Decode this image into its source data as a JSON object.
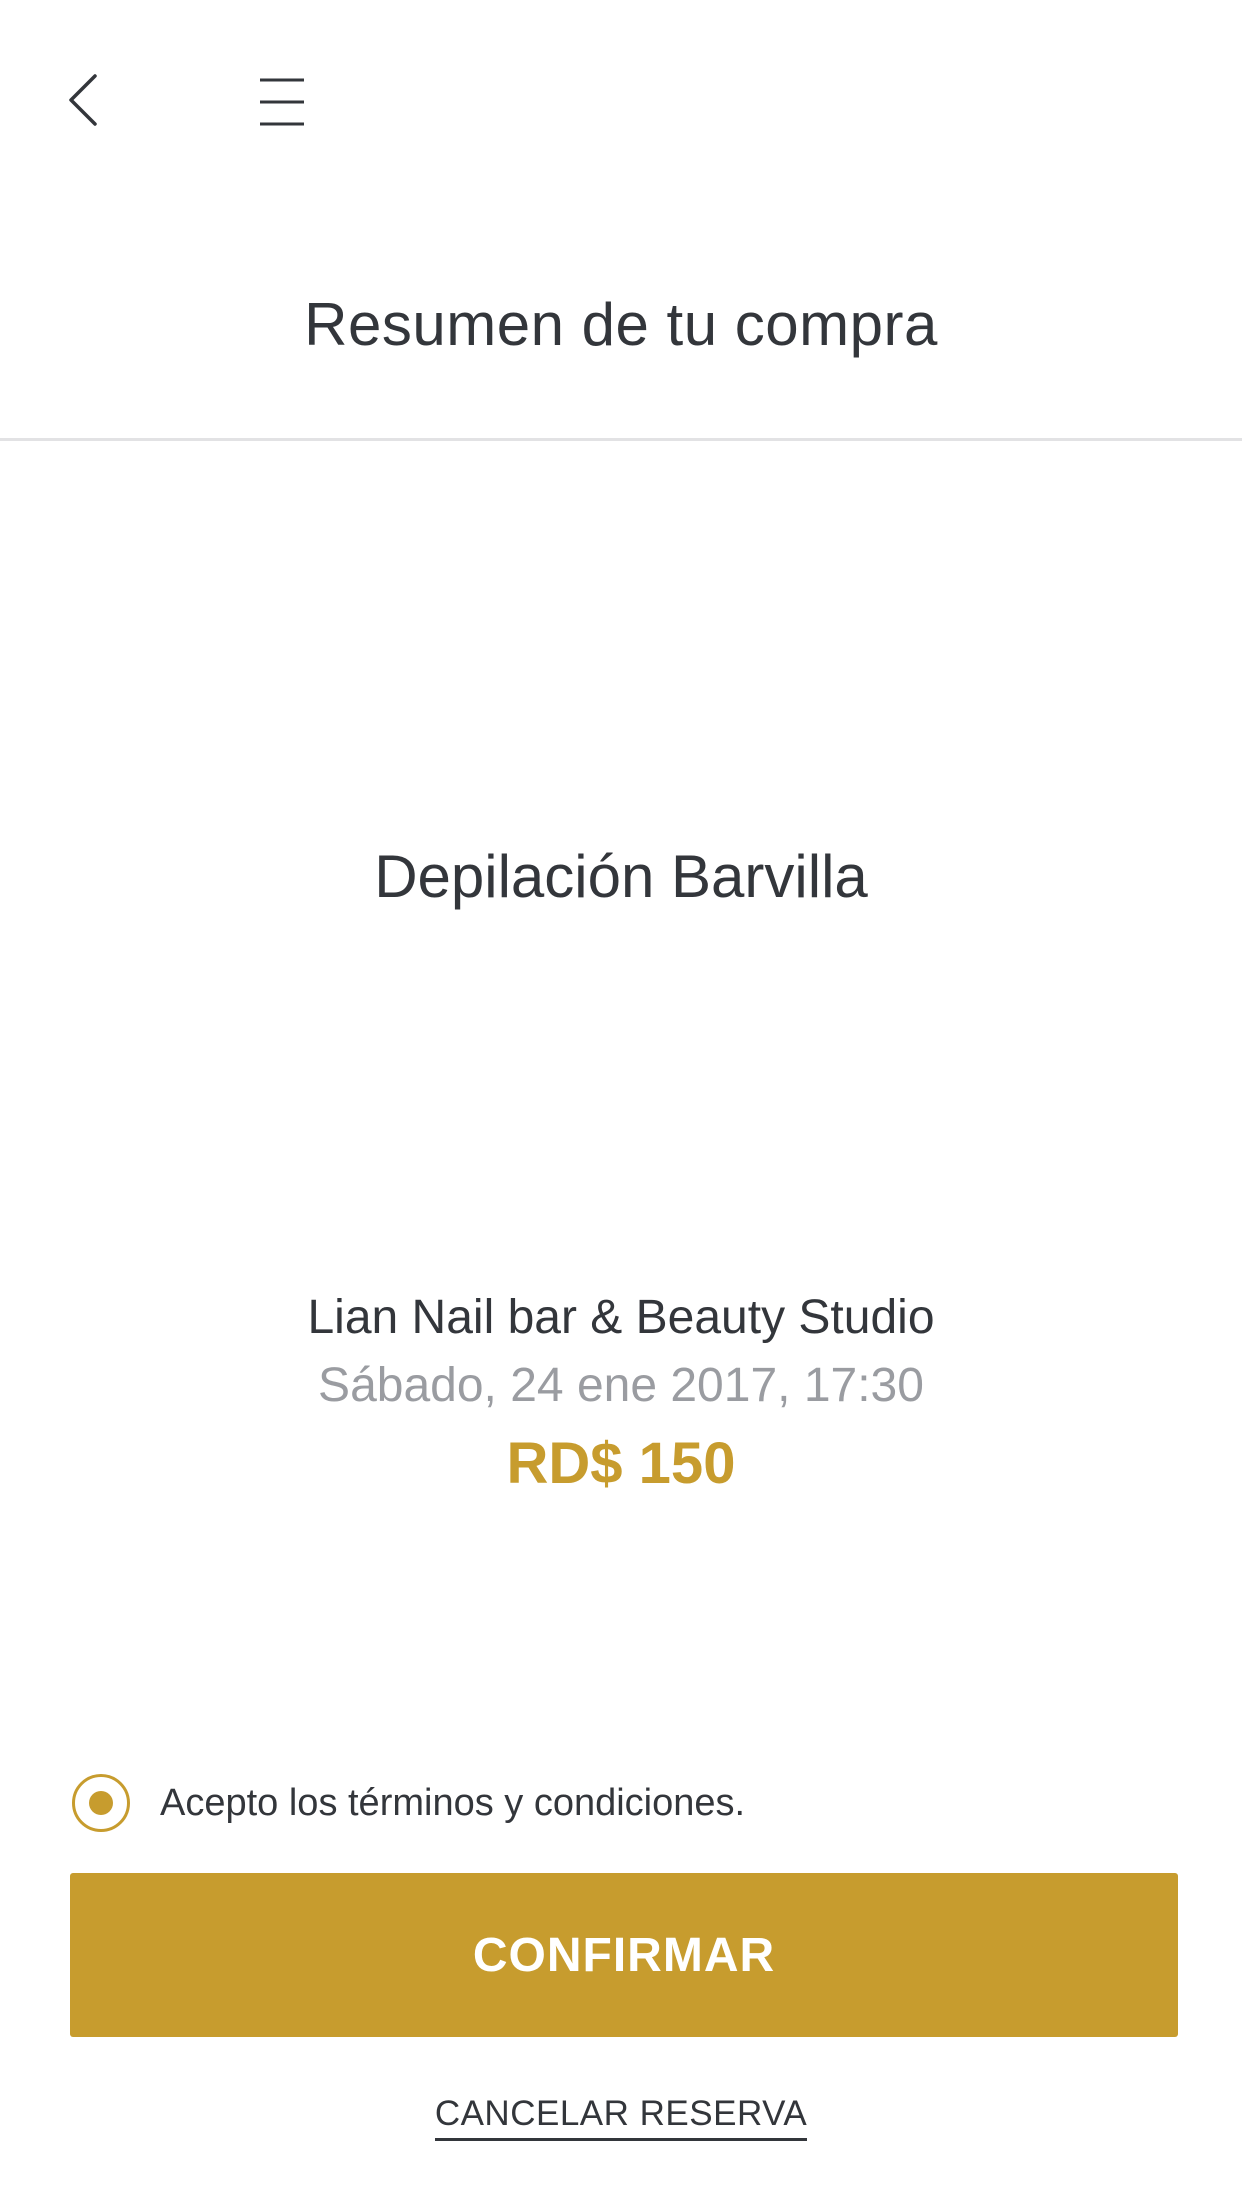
{
  "header": {
    "back_icon": "chevron-left-icon",
    "menu_icon": "hamburger-menu-icon"
  },
  "summary": {
    "title": "Resumen de tu compra",
    "service_name": "Depilación Barvilla",
    "studio_name": "Lian Nail bar & Beauty Studio",
    "datetime": "Sábado, 24 ene 2017, 17:30",
    "price": "RD$ 150"
  },
  "terms": {
    "label": "Acepto los términos y condiciones.",
    "checked": true
  },
  "actions": {
    "confirm_label": "CONFIRMAR",
    "cancel_label": "CANCELAR RESERVA"
  },
  "colors": {
    "accent": "#c79c2e",
    "text": "#33363b",
    "muted": "#9a9ca1",
    "divider": "#e2e2e4"
  }
}
